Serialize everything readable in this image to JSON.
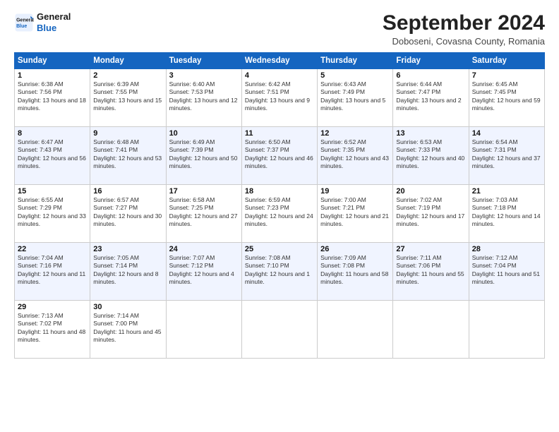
{
  "logo": {
    "line1": "General",
    "line2": "Blue"
  },
  "title": "September 2024",
  "subtitle": "Doboseni, Covasna County, Romania",
  "days_header": [
    "Sunday",
    "Monday",
    "Tuesday",
    "Wednesday",
    "Thursday",
    "Friday",
    "Saturday"
  ],
  "weeks": [
    [
      {
        "day": "1",
        "sunrise": "Sunrise: 6:38 AM",
        "sunset": "Sunset: 7:56 PM",
        "daylight": "Daylight: 13 hours and 18 minutes."
      },
      {
        "day": "2",
        "sunrise": "Sunrise: 6:39 AM",
        "sunset": "Sunset: 7:55 PM",
        "daylight": "Daylight: 13 hours and 15 minutes."
      },
      {
        "day": "3",
        "sunrise": "Sunrise: 6:40 AM",
        "sunset": "Sunset: 7:53 PM",
        "daylight": "Daylight: 13 hours and 12 minutes."
      },
      {
        "day": "4",
        "sunrise": "Sunrise: 6:42 AM",
        "sunset": "Sunset: 7:51 PM",
        "daylight": "Daylight: 13 hours and 9 minutes."
      },
      {
        "day": "5",
        "sunrise": "Sunrise: 6:43 AM",
        "sunset": "Sunset: 7:49 PM",
        "daylight": "Daylight: 13 hours and 5 minutes."
      },
      {
        "day": "6",
        "sunrise": "Sunrise: 6:44 AM",
        "sunset": "Sunset: 7:47 PM",
        "daylight": "Daylight: 13 hours and 2 minutes."
      },
      {
        "day": "7",
        "sunrise": "Sunrise: 6:45 AM",
        "sunset": "Sunset: 7:45 PM",
        "daylight": "Daylight: 12 hours and 59 minutes."
      }
    ],
    [
      {
        "day": "8",
        "sunrise": "Sunrise: 6:47 AM",
        "sunset": "Sunset: 7:43 PM",
        "daylight": "Daylight: 12 hours and 56 minutes."
      },
      {
        "day": "9",
        "sunrise": "Sunrise: 6:48 AM",
        "sunset": "Sunset: 7:41 PM",
        "daylight": "Daylight: 12 hours and 53 minutes."
      },
      {
        "day": "10",
        "sunrise": "Sunrise: 6:49 AM",
        "sunset": "Sunset: 7:39 PM",
        "daylight": "Daylight: 12 hours and 50 minutes."
      },
      {
        "day": "11",
        "sunrise": "Sunrise: 6:50 AM",
        "sunset": "Sunset: 7:37 PM",
        "daylight": "Daylight: 12 hours and 46 minutes."
      },
      {
        "day": "12",
        "sunrise": "Sunrise: 6:52 AM",
        "sunset": "Sunset: 7:35 PM",
        "daylight": "Daylight: 12 hours and 43 minutes."
      },
      {
        "day": "13",
        "sunrise": "Sunrise: 6:53 AM",
        "sunset": "Sunset: 7:33 PM",
        "daylight": "Daylight: 12 hours and 40 minutes."
      },
      {
        "day": "14",
        "sunrise": "Sunrise: 6:54 AM",
        "sunset": "Sunset: 7:31 PM",
        "daylight": "Daylight: 12 hours and 37 minutes."
      }
    ],
    [
      {
        "day": "15",
        "sunrise": "Sunrise: 6:55 AM",
        "sunset": "Sunset: 7:29 PM",
        "daylight": "Daylight: 12 hours and 33 minutes."
      },
      {
        "day": "16",
        "sunrise": "Sunrise: 6:57 AM",
        "sunset": "Sunset: 7:27 PM",
        "daylight": "Daylight: 12 hours and 30 minutes."
      },
      {
        "day": "17",
        "sunrise": "Sunrise: 6:58 AM",
        "sunset": "Sunset: 7:25 PM",
        "daylight": "Daylight: 12 hours and 27 minutes."
      },
      {
        "day": "18",
        "sunrise": "Sunrise: 6:59 AM",
        "sunset": "Sunset: 7:23 PM",
        "daylight": "Daylight: 12 hours and 24 minutes."
      },
      {
        "day": "19",
        "sunrise": "Sunrise: 7:00 AM",
        "sunset": "Sunset: 7:21 PM",
        "daylight": "Daylight: 12 hours and 21 minutes."
      },
      {
        "day": "20",
        "sunrise": "Sunrise: 7:02 AM",
        "sunset": "Sunset: 7:19 PM",
        "daylight": "Daylight: 12 hours and 17 minutes."
      },
      {
        "day": "21",
        "sunrise": "Sunrise: 7:03 AM",
        "sunset": "Sunset: 7:18 PM",
        "daylight": "Daylight: 12 hours and 14 minutes."
      }
    ],
    [
      {
        "day": "22",
        "sunrise": "Sunrise: 7:04 AM",
        "sunset": "Sunset: 7:16 PM",
        "daylight": "Daylight: 12 hours and 11 minutes."
      },
      {
        "day": "23",
        "sunrise": "Sunrise: 7:05 AM",
        "sunset": "Sunset: 7:14 PM",
        "daylight": "Daylight: 12 hours and 8 minutes."
      },
      {
        "day": "24",
        "sunrise": "Sunrise: 7:07 AM",
        "sunset": "Sunset: 7:12 PM",
        "daylight": "Daylight: 12 hours and 4 minutes."
      },
      {
        "day": "25",
        "sunrise": "Sunrise: 7:08 AM",
        "sunset": "Sunset: 7:10 PM",
        "daylight": "Daylight: 12 hours and 1 minute."
      },
      {
        "day": "26",
        "sunrise": "Sunrise: 7:09 AM",
        "sunset": "Sunset: 7:08 PM",
        "daylight": "Daylight: 11 hours and 58 minutes."
      },
      {
        "day": "27",
        "sunrise": "Sunrise: 7:11 AM",
        "sunset": "Sunset: 7:06 PM",
        "daylight": "Daylight: 11 hours and 55 minutes."
      },
      {
        "day": "28",
        "sunrise": "Sunrise: 7:12 AM",
        "sunset": "Sunset: 7:04 PM",
        "daylight": "Daylight: 11 hours and 51 minutes."
      }
    ],
    [
      {
        "day": "29",
        "sunrise": "Sunrise: 7:13 AM",
        "sunset": "Sunset: 7:02 PM",
        "daylight": "Daylight: 11 hours and 48 minutes."
      },
      {
        "day": "30",
        "sunrise": "Sunrise: 7:14 AM",
        "sunset": "Sunset: 7:00 PM",
        "daylight": "Daylight: 11 hours and 45 minutes."
      },
      null,
      null,
      null,
      null,
      null
    ]
  ]
}
